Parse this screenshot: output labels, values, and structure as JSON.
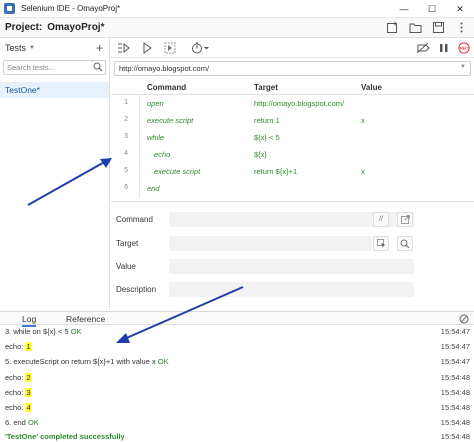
{
  "window": {
    "title": "Selenium IDE - OmayoProj*",
    "controls": [
      "—",
      "☐",
      "✕"
    ]
  },
  "project": {
    "label": "Project:",
    "name": "OmayoProj*"
  },
  "sidebar": {
    "header": "Tests",
    "search_placeholder": "Search tests...",
    "tests": [
      "TestOne*"
    ]
  },
  "url": "http://omayo.blogspot.com/",
  "table": {
    "headers": [
      "Command",
      "Target",
      "Value"
    ],
    "rows": [
      {
        "num": "1",
        "command": "open",
        "target": "http://omayo.blogspot.com/",
        "value": "",
        "indent": 0
      },
      {
        "num": "2",
        "command": "execute script",
        "target": "return 1",
        "value": "x",
        "indent": 0
      },
      {
        "num": "3",
        "command": "while",
        "target": "${x} < 5",
        "value": "",
        "indent": 0
      },
      {
        "num": "4",
        "command": "echo",
        "target": "${x}",
        "value": "",
        "indent": 1
      },
      {
        "num": "5",
        "command": "execute script",
        "target": "return ${x}+1",
        "value": "x",
        "indent": 1
      },
      {
        "num": "6",
        "command": "end",
        "target": "",
        "value": "",
        "indent": 0
      }
    ]
  },
  "editor": {
    "command_label": "Command",
    "target_label": "Target",
    "value_label": "Value",
    "description_label": "Description",
    "comment_btn": "//"
  },
  "log": {
    "tabs": [
      "Log",
      "Reference"
    ],
    "lines": [
      {
        "parts": [
          {
            "t": "3.  while on ${x} < 5 ",
            "c": ""
          },
          {
            "t": "OK",
            "c": "ok"
          }
        ],
        "time": "15:54:47"
      },
      {
        "parts": [
          {
            "t": "echo: ",
            "c": ""
          },
          {
            "t": "1",
            "c": "hl"
          }
        ],
        "time": "15:54:47"
      },
      {
        "parts": [
          {
            "t": "5.  executeScript on return ${x}+1 with value x ",
            "c": ""
          },
          {
            "t": "OK",
            "c": "ok"
          }
        ],
        "time": "15:54:47"
      },
      {
        "parts": [
          {
            "t": "echo: ",
            "c": ""
          },
          {
            "t": "2",
            "c": "hl"
          }
        ],
        "time": "15:54:48"
      },
      {
        "parts": [
          {
            "t": "echo: ",
            "c": ""
          },
          {
            "t": "3",
            "c": "hl"
          }
        ],
        "time": "15:54:48"
      },
      {
        "parts": [
          {
            "t": "echo: ",
            "c": ""
          },
          {
            "t": "4",
            "c": "hl"
          }
        ],
        "time": "15:54:48"
      },
      {
        "parts": [
          {
            "t": "6.  end ",
            "c": ""
          },
          {
            "t": "OK",
            "c": "ok"
          }
        ],
        "time": "15:54:48"
      },
      {
        "parts": [
          {
            "t": "'TestOne' completed successfully",
            "c": "succ"
          }
        ],
        "time": "15:54:48"
      }
    ]
  },
  "colors": {
    "command_green": "#2e8b2e",
    "highlight": "#ffff3a",
    "arrow_blue": "#1f3fa8",
    "selected_row": "#e6f1fb"
  }
}
